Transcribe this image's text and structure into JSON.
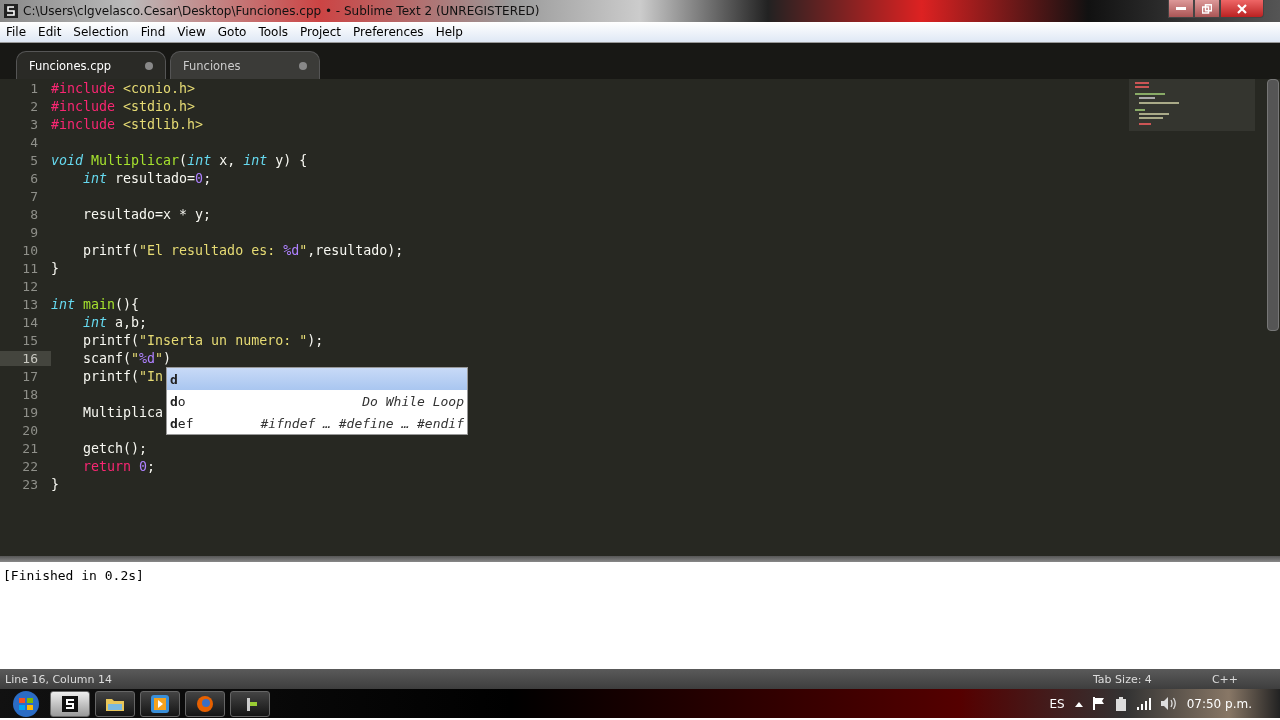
{
  "window": {
    "title": "C:\\Users\\clgvelasco.Cesar\\Desktop\\Funciones.cpp • - Sublime Text 2 (UNREGISTERED)"
  },
  "menu": [
    "File",
    "Edit",
    "Selection",
    "Find",
    "View",
    "Goto",
    "Tools",
    "Project",
    "Preferences",
    "Help"
  ],
  "tabs": [
    {
      "label": "Funciones.cpp",
      "selected": true,
      "modified": true
    },
    {
      "label": "Funciones",
      "selected": false,
      "modified": true
    }
  ],
  "editor": {
    "lines": [
      {
        "number": "1",
        "current": false,
        "tokens": [
          {
            "text": "#include",
            "kind": "keyword"
          },
          {
            "text": " <conio.h>",
            "kind": "string"
          }
        ]
      },
      {
        "number": "2",
        "current": false,
        "tokens": [
          {
            "text": "#include",
            "kind": "keyword"
          },
          {
            "text": " <stdio.h>",
            "kind": "string"
          }
        ]
      },
      {
        "number": "3",
        "current": false,
        "tokens": [
          {
            "text": "#include",
            "kind": "keyword"
          },
          {
            "text": " <stdlib.h>",
            "kind": "string"
          }
        ]
      },
      {
        "number": "4",
        "current": false
      },
      {
        "number": "5",
        "current": false,
        "tokens": [
          {
            "text": "void",
            "kind": "type"
          },
          {
            "text": " Multiplicar",
            "kind": "function"
          },
          {
            "text": "(",
            "kind": "plain"
          },
          {
            "text": "int",
            "kind": "type"
          },
          {
            "text": " x, ",
            "kind": "plain"
          },
          {
            "text": "int",
            "kind": "type"
          },
          {
            "text": " y) {",
            "kind": "plain"
          }
        ]
      },
      {
        "number": "6",
        "current": false,
        "tokens": [
          {
            "text": "    int",
            "kind": "type"
          },
          {
            "text": " resultado=",
            "kind": "plain"
          },
          {
            "text": "0",
            "kind": "constant"
          },
          {
            "text": ";",
            "kind": "plain"
          }
        ]
      },
      {
        "number": "7",
        "current": false
      },
      {
        "number": "8",
        "current": false,
        "tokens": [
          {
            "text": "    resultado=x * y;",
            "kind": "plain"
          }
        ]
      },
      {
        "number": "9",
        "current": false
      },
      {
        "number": "10",
        "current": false,
        "tokens": [
          {
            "text": "    printf(",
            "kind": "plain"
          },
          {
            "text": "\"El resultado es: ",
            "kind": "string"
          },
          {
            "text": "%d",
            "kind": "constant"
          },
          {
            "text": "\"",
            "kind": "string"
          },
          {
            "text": ",resultado);",
            "kind": "plain"
          }
        ]
      },
      {
        "number": "11",
        "current": false,
        "tokens": [
          {
            "text": "}",
            "kind": "plain"
          }
        ]
      },
      {
        "number": "12",
        "current": false
      },
      {
        "number": "13",
        "current": false,
        "tokens": [
          {
            "text": "int",
            "kind": "type"
          },
          {
            "text": " main",
            "kind": "function"
          },
          {
            "text": "(){",
            "kind": "plain"
          }
        ]
      },
      {
        "number": "14",
        "current": false,
        "tokens": [
          {
            "text": "    int",
            "kind": "type"
          },
          {
            "text": " a,b;",
            "kind": "plain"
          }
        ]
      },
      {
        "number": "15",
        "current": false,
        "tokens": [
          {
            "text": "    printf(",
            "kind": "plain"
          },
          {
            "text": "\"Inserta un numero: \"",
            "kind": "string"
          },
          {
            "text": ");",
            "kind": "plain"
          }
        ]
      },
      {
        "number": "16",
        "current": true,
        "tokens": [
          {
            "text": "    scanf(",
            "kind": "plain"
          },
          {
            "text": "\"",
            "kind": "string"
          },
          {
            "text": "%d",
            "kind": "constant"
          },
          {
            "text": "\"",
            "kind": "string"
          },
          {
            "text": ")",
            "kind": "plain"
          }
        ]
      },
      {
        "number": "17",
        "current": false,
        "tokens": [
          {
            "text": "    printf(",
            "kind": "plain"
          },
          {
            "text": "\"In",
            "kind": "string"
          }
        ]
      },
      {
        "number": "18",
        "current": false
      },
      {
        "number": "19",
        "current": false,
        "tokens": [
          {
            "text": "    Multiplica",
            "kind": "plain"
          }
        ]
      },
      {
        "number": "20",
        "current": false
      },
      {
        "number": "21",
        "current": false,
        "tokens": [
          {
            "text": "    getch();",
            "kind": "plain"
          }
        ]
      },
      {
        "number": "22",
        "current": false,
        "tokens": [
          {
            "text": "    return",
            "kind": "keyword"
          },
          {
            "text": " 0",
            "kind": "constant"
          },
          {
            "text": ";",
            "kind": "plain"
          }
        ]
      },
      {
        "number": "23",
        "current": false,
        "tokens": [
          {
            "text": "}",
            "kind": "plain"
          }
        ]
      }
    ]
  },
  "autocomplete": [
    {
      "label": "**d**",
      "selected": true
    },
    {
      "label": "**d**o",
      "hint": "Do While Loop",
      "selected": false
    },
    {
      "label": "**d**ef",
      "hint": "#ifndef … #define … #endif",
      "selected": false
    }
  ],
  "output": {
    "text": "[Finished in 0.2s]"
  },
  "status_bar": {
    "position": "Line 16, Column 14",
    "tab_size": "Tab Size: 4",
    "syntax": "C++"
  },
  "taskbar": {
    "apps": [
      {
        "kind": "sublime",
        "selected": true
      },
      {
        "kind": "folder",
        "selected": false
      },
      {
        "kind": "media",
        "selected": false
      },
      {
        "kind": "firefox",
        "selected": false
      },
      {
        "kind": "tool",
        "selected": false
      }
    ],
    "language": "ES",
    "time": "07:50 p.m."
  }
}
